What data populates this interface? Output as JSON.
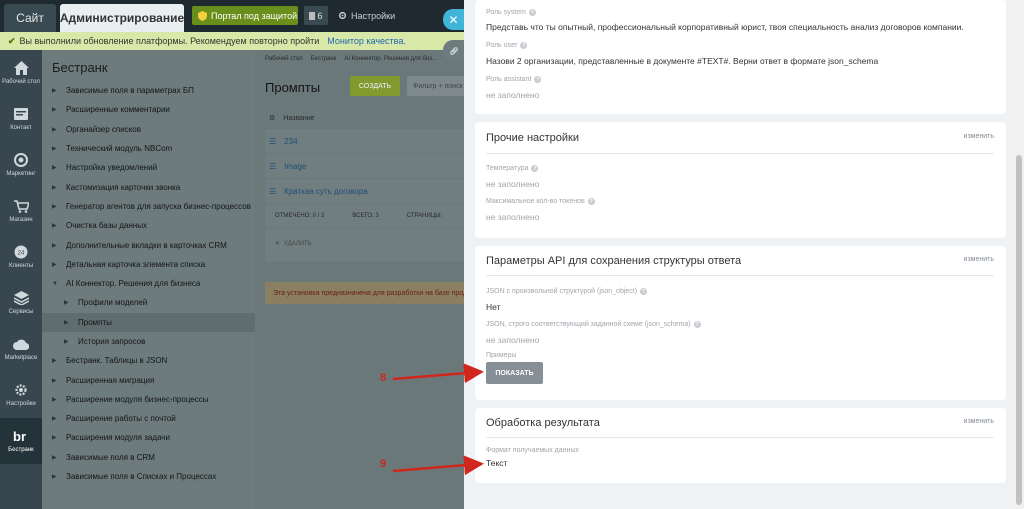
{
  "topbar": {
    "site_tab": "Сайт",
    "admin_tab": "Администрирование",
    "portal_button": "Портал под защитой",
    "count_badge": "6",
    "settings_link": "Настройки"
  },
  "notice": {
    "text": "Вы выполнили обновление платформы. Рекомендуем повторно пройти",
    "link": "Монитор качества."
  },
  "rail": [
    {
      "label": "Рабочий стол",
      "icon": "home-icon"
    },
    {
      "label": "Контакт",
      "icon": "contact-icon"
    },
    {
      "label": "Маркетинг",
      "icon": "marketing-icon"
    },
    {
      "label": "Магазин",
      "icon": "cart-icon"
    },
    {
      "label": "Клиенты",
      "icon": "clients-icon"
    },
    {
      "label": "Сервисы",
      "icon": "layers-icon"
    },
    {
      "label": "Marketplace",
      "icon": "cloud-icon"
    },
    {
      "label": "Настройки",
      "icon": "gear-icon"
    },
    {
      "label": "Бестранк",
      "icon": "bestrank-logo-icon"
    }
  ],
  "menu": {
    "title": "Бестранк",
    "items": [
      {
        "label": "Зависимые поля в параметрах БП"
      },
      {
        "label": "Расширенные комментарии"
      },
      {
        "label": "Органайзер списков"
      },
      {
        "label": "Технический модуль NBCom"
      },
      {
        "label": "Настройка уведомлений"
      },
      {
        "label": "Кастомизация карточки звонка"
      },
      {
        "label": "Генератор агентов для запуска бизнес-процессов"
      },
      {
        "label": "Очистка базы данных"
      },
      {
        "label": "Дополнительные вкладки в карточках CRM"
      },
      {
        "label": "Детальная карточка элемента списка"
      },
      {
        "label": "AI Коннектор. Решения для бизнеса"
      },
      {
        "label": "Профили моделей"
      },
      {
        "label": "Промпты"
      },
      {
        "label": "История запросов"
      },
      {
        "label": "Бестранк. Таблицы в JSON"
      },
      {
        "label": "Расширенная миграция"
      },
      {
        "label": "Расширение модуля бизнес-процессы"
      },
      {
        "label": "Расширение работы с почтой"
      },
      {
        "label": "Расширения модуля задачи"
      },
      {
        "label": "Зависимые поля в CRM"
      },
      {
        "label": "Зависимые поля в Списках и Процессах"
      }
    ]
  },
  "content": {
    "breadcrumbs": [
      "Рабочий стол",
      "Бестранк",
      "AI Коннектор. Решения для биз..."
    ],
    "title": "Промпты",
    "create_button": "СОЗДАТЬ",
    "filter_placeholder": "Фильтр + поиск",
    "grid_header": "Название",
    "rows": [
      "234",
      "Image",
      "Краткая суть договора"
    ],
    "footer": {
      "selected": "ОТМЕЧЕНО: 0 / 3",
      "total": "ВСЕГО: 3",
      "pages": "СТРАНИЦЫ:"
    },
    "delete_label": "УДАЛИТЬ",
    "warning": "Эта установка предназначена для разработки на базе прод..."
  },
  "panel": {
    "roles": {
      "system_label": "Роль system",
      "system_value": "Представь что ты опытный, профессиональный корпоративный юрист, твоя специальность анализ договоров компании.",
      "user_label": "Роль user",
      "user_value": "Назови 2 организации, представленные в документе #TEXT#. Верни ответ в формате json_schema",
      "assistant_label": "Роль assistant",
      "assistant_value": "не заполнено"
    },
    "other": {
      "title": "Прочие настройки",
      "edit": "изменить",
      "temp_label": "Температура",
      "temp_value": "не заполнено",
      "tokens_label": "Максимальное кол-во токенов",
      "tokens_value": "не заполнено"
    },
    "api": {
      "title": "Параметры API для сохранения структуры ответа",
      "edit": "изменить",
      "json_label": "JSON с произвольной структурой (json_object)",
      "json_value": "Нет",
      "schema_label": "JSON, строго соответствующий заданной схеме (json_schema)",
      "schema_value": "не заполнено",
      "examples_label": "Примеры",
      "show_button": "ПОКАЗАТЬ"
    },
    "result": {
      "title": "Обработка результата",
      "edit": "изменить",
      "format_label": "Формат получаемых данных",
      "format_value": "Текст"
    }
  },
  "annotations": [
    "8",
    "9"
  ],
  "colors": {
    "accent_green": "#6a8e1c",
    "close_blue": "#41b5d8",
    "annotation_red": "#d0261c"
  }
}
